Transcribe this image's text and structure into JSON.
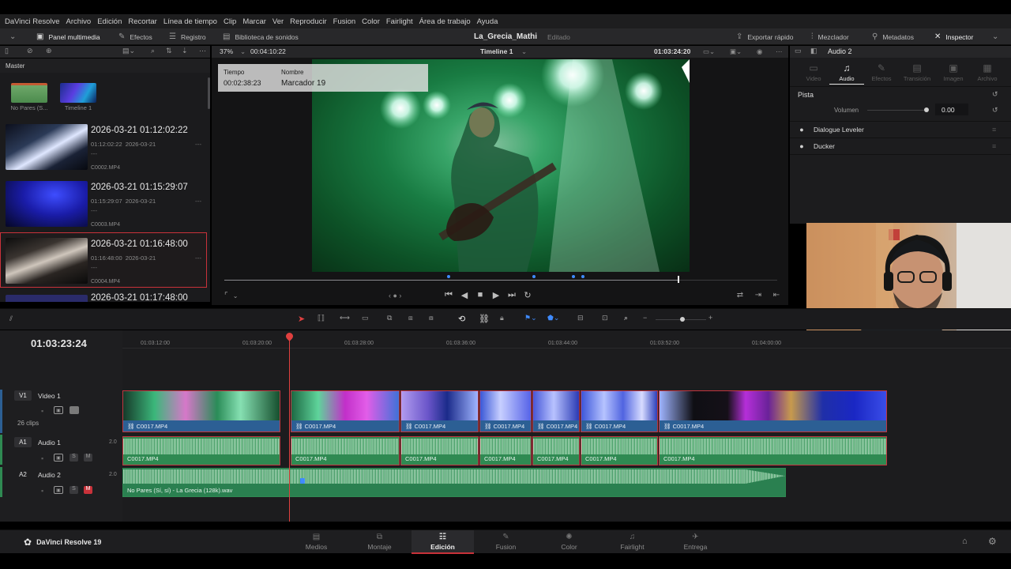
{
  "menubar": [
    "DaVinci Resolve",
    "Archivo",
    "Edición",
    "Recortar",
    "Línea de tiempo",
    "Clip",
    "Marcar",
    "Ver",
    "Reproducir",
    "Fusion",
    "Color",
    "Fairlight",
    "Área de trabajo",
    "Ayuda"
  ],
  "toolbar": {
    "media_pool": "Panel multimedia",
    "effects": "Efectos",
    "index": "Registro",
    "sound_library": "Biblioteca de sonidos",
    "project_title": "La_Grecia_Mathi",
    "project_status": "Editado",
    "quick_export": "Exportar rápido",
    "mixer": "Mezclador",
    "metadata": "Metadatos",
    "inspector": "Inspector"
  },
  "media_pool": {
    "bin": "Master",
    "bins": [
      {
        "label": "No Pares (S..."
      },
      {
        "label": "Timeline 1"
      }
    ],
    "clips": [
      {
        "title": "2026-03-21  01:12:02:22",
        "tc": "01:12:02:22",
        "date": "2026-03-21",
        "dash": "---",
        "file": "C0002.MP4"
      },
      {
        "title": "2026-03-21  01:15:29:07",
        "tc": "01:15:29:07",
        "date": "2026-03-21",
        "dash": "---",
        "file": "C0003.MP4"
      },
      {
        "title": "2026-03-21  01:16:48:00",
        "tc": "01:16:48:00",
        "date": "2026-03-21",
        "dash": "---",
        "file": "C0004.MP4"
      },
      {
        "title": "2026-03-21  01:17:48:00"
      }
    ]
  },
  "viewer": {
    "zoom": "37%",
    "source_tc": "00:04:10:22",
    "timeline_name": "Timeline 1",
    "record_tc": "01:03:24:20",
    "marker": {
      "time_label": "Tiempo",
      "time": "00:02:38:23",
      "name_label": "Nombre",
      "name": "Marcador 19"
    },
    "playhead_fraction": 0.82
  },
  "inspector": {
    "clip_name": "Audio 2",
    "tabs": [
      {
        "label": "Video",
        "icon": "video-icon"
      },
      {
        "label": "Audio",
        "icon": "music-note-icon"
      },
      {
        "label": "Efectos",
        "icon": "effects-icon"
      },
      {
        "label": "Transición",
        "icon": "transition-icon"
      },
      {
        "label": "Imagen",
        "icon": "image-icon"
      },
      {
        "label": "Archivo",
        "icon": "file-icon"
      }
    ],
    "active_tab": "Audio",
    "section": "Pista",
    "volume_label": "Volumen",
    "volume_value": "0.00",
    "effects": [
      "Dialogue Leveler",
      "Ducker"
    ]
  },
  "timeline": {
    "timecode": "01:03:23:24",
    "ruler": [
      "01:03:12:00",
      "01:03:20:00",
      "01:03:28:00",
      "01:03:36:00",
      "01:03:44:00",
      "01:03:52:00",
      "01:04:00:00"
    ],
    "tracks": {
      "v1": {
        "id": "V1",
        "name": "Video 1",
        "count": "26 clips"
      },
      "a1": {
        "id": "A1",
        "name": "Audio 1",
        "level": "2.0"
      },
      "a2": {
        "id": "A2",
        "name": "Audio 2",
        "level": "2.0"
      }
    },
    "clip_name": "C0017.MP4",
    "a2_clip_name": "No Pares (Sí, sí) - La Grecia (128k).wav",
    "mute_label": "M",
    "solo_label": "S"
  },
  "pages": [
    {
      "label": "Medios",
      "icon": "media-icon"
    },
    {
      "label": "Montaje",
      "icon": "cut-icon"
    },
    {
      "label": "Edición",
      "icon": "edit-icon"
    },
    {
      "label": "Fusion",
      "icon": "fusion-icon"
    },
    {
      "label": "Color",
      "icon": "color-icon"
    },
    {
      "label": "Fairlight",
      "icon": "fairlight-icon"
    },
    {
      "label": "Entrega",
      "icon": "deliver-icon"
    }
  ],
  "active_page": "Edición",
  "app_name": "DaVinci Resolve 19",
  "colors": {
    "accent_red": "#c23640",
    "video_clip": "#2c5f94",
    "audio_clip": "#2f8a52",
    "mute_active": "#c9323a"
  }
}
